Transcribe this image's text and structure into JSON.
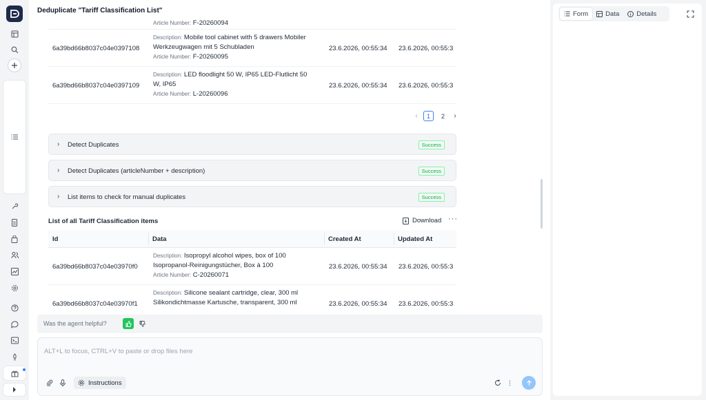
{
  "header": {
    "title": "Deduplicate \"Tariff Classification List\""
  },
  "labels": {
    "description": "Description:",
    "article_number": "Article Number:"
  },
  "top_rows": [
    {
      "article_number": "F-20260094"
    },
    {
      "id": "6a39bd66b8037c04e0397108",
      "description_line1": "Mobile tool cabinet with 5 drawers Mobiler",
      "description_line2": "Werkzeugwagen mit 5 Schubladen",
      "article_number": "F-20260095",
      "created_at": "23.6.2026, 00:55:34",
      "updated_at": "23.6.2026, 00:55:3"
    },
    {
      "id": "6a39bd66b8037c04e0397109",
      "description_line1": "LED floodlight 50 W, IP65 LED-Flutlicht 50",
      "description_line2": "W, IP65",
      "article_number": "L-20260096",
      "created_at": "23.6.2026, 00:55:34",
      "updated_at": "23.6.2026, 00:55:3"
    }
  ],
  "pagination": {
    "prev": "‹",
    "page1": "1",
    "page2": "2",
    "next": "›"
  },
  "steps": [
    {
      "label": "Detect Duplicates",
      "status": "Success"
    },
    {
      "label": "Detect Duplicates (articleNumber + description)",
      "status": "Success"
    },
    {
      "label": "List items to check for manual duplicates",
      "status": "Success"
    }
  ],
  "list": {
    "title": "List of all Tariff Classification items",
    "download_label": "Download",
    "more": "···",
    "columns": [
      "Id",
      "Data",
      "Created At",
      "Updated At"
    ],
    "rows": [
      {
        "id": "6a39bd66b8037c04e03970f0",
        "description_line1": "Isopropyl alcohol wipes, box of 100",
        "description_line2": "Isopropanol-Reinigungstücher, Box à 100",
        "article_number": "C-20260071",
        "created_at": "23.6.2026, 00:55:34",
        "updated_at": "23.6.2026, 00:55:3"
      },
      {
        "id": "6a39bd66b8037c04e03970f1",
        "description_line1": "Silicone sealant cartridge, clear, 300 ml",
        "description_line2": "Silikondichtmasse Kartusche, transparent, 300 ml",
        "created_at": "23.6.2026, 00:55:34",
        "updated_at": "23.6.2026, 00:55:3"
      }
    ]
  },
  "feedback": {
    "question": "Was the agent helpful?"
  },
  "composer": {
    "placeholder": "ALT+L to focus, CTRL+V to paste or drop files here",
    "instructions_label": "Instructions"
  },
  "right_panel": {
    "tabs": [
      {
        "label": "Form",
        "icon": "list-icon",
        "active": true
      },
      {
        "label": "Data",
        "icon": "table-icon",
        "active": false
      },
      {
        "label": "Details",
        "icon": "info-icon",
        "active": false
      }
    ]
  },
  "colors": {
    "accent": "#3b82f6",
    "success": "#16a34a",
    "logo_bg": "#1e2a4a",
    "thumb_up": "#22c55e"
  }
}
